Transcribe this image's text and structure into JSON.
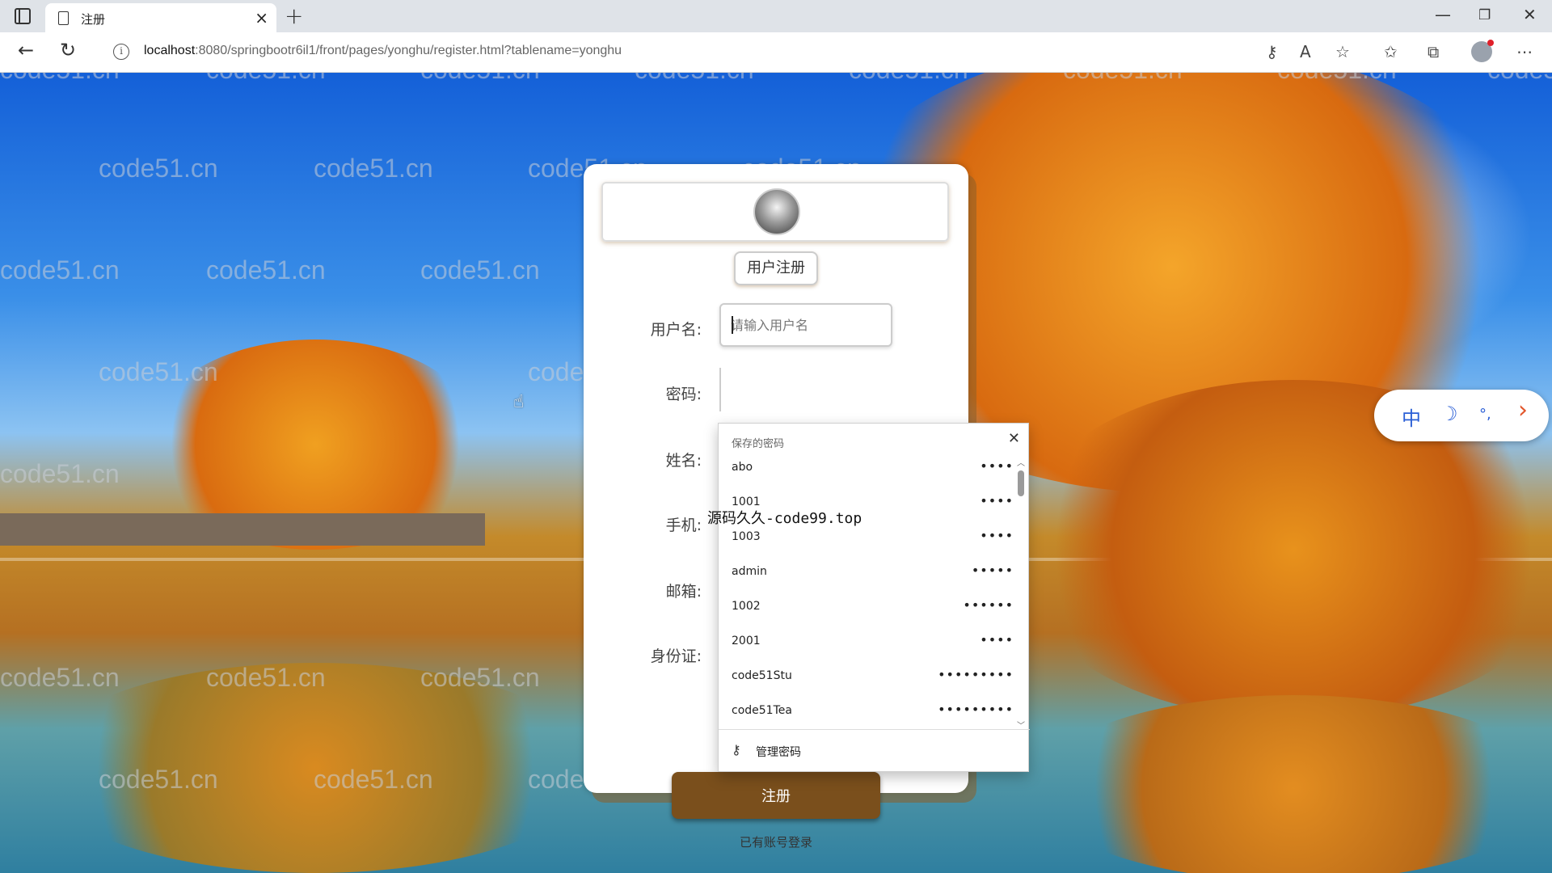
{
  "browser": {
    "tab_title": "注册",
    "url_host": "localhost",
    "url_rest": ":8080/springbootr6il1/front/pages/yonghu/register.html?tablename=yonghu"
  },
  "watermark_text": "code51.cn",
  "overlay_text": "源码久久-code99.top",
  "form": {
    "title": "用户注册",
    "labels": {
      "username": "用户名:",
      "password": "密码:",
      "name": "姓名:",
      "phone": "手机:",
      "email": "邮箱:",
      "idcard": "身份证:"
    },
    "username_placeholder": "请输入用户名",
    "submit_label": "注册",
    "login_link": "已有账号登录",
    "accent_color": "#7a4f1c"
  },
  "saved_passwords": {
    "title": "保存的密码",
    "items": [
      {
        "user": "abo",
        "mask": "••••"
      },
      {
        "user": "1001",
        "mask": "••••"
      },
      {
        "user": "1003",
        "mask": "••••"
      },
      {
        "user": "admin",
        "mask": "•••••"
      },
      {
        "user": "1002",
        "mask": "••••••"
      },
      {
        "user": "2001",
        "mask": "••••"
      },
      {
        "user": "code51Stu",
        "mask": "•••••••••"
      },
      {
        "user": "code51Tea",
        "mask": "•••••••••"
      }
    ],
    "manage_label": "管理密码"
  },
  "ime": {
    "mode": "中",
    "moon": "☽",
    "punct": "°,",
    "arrow": "›"
  }
}
